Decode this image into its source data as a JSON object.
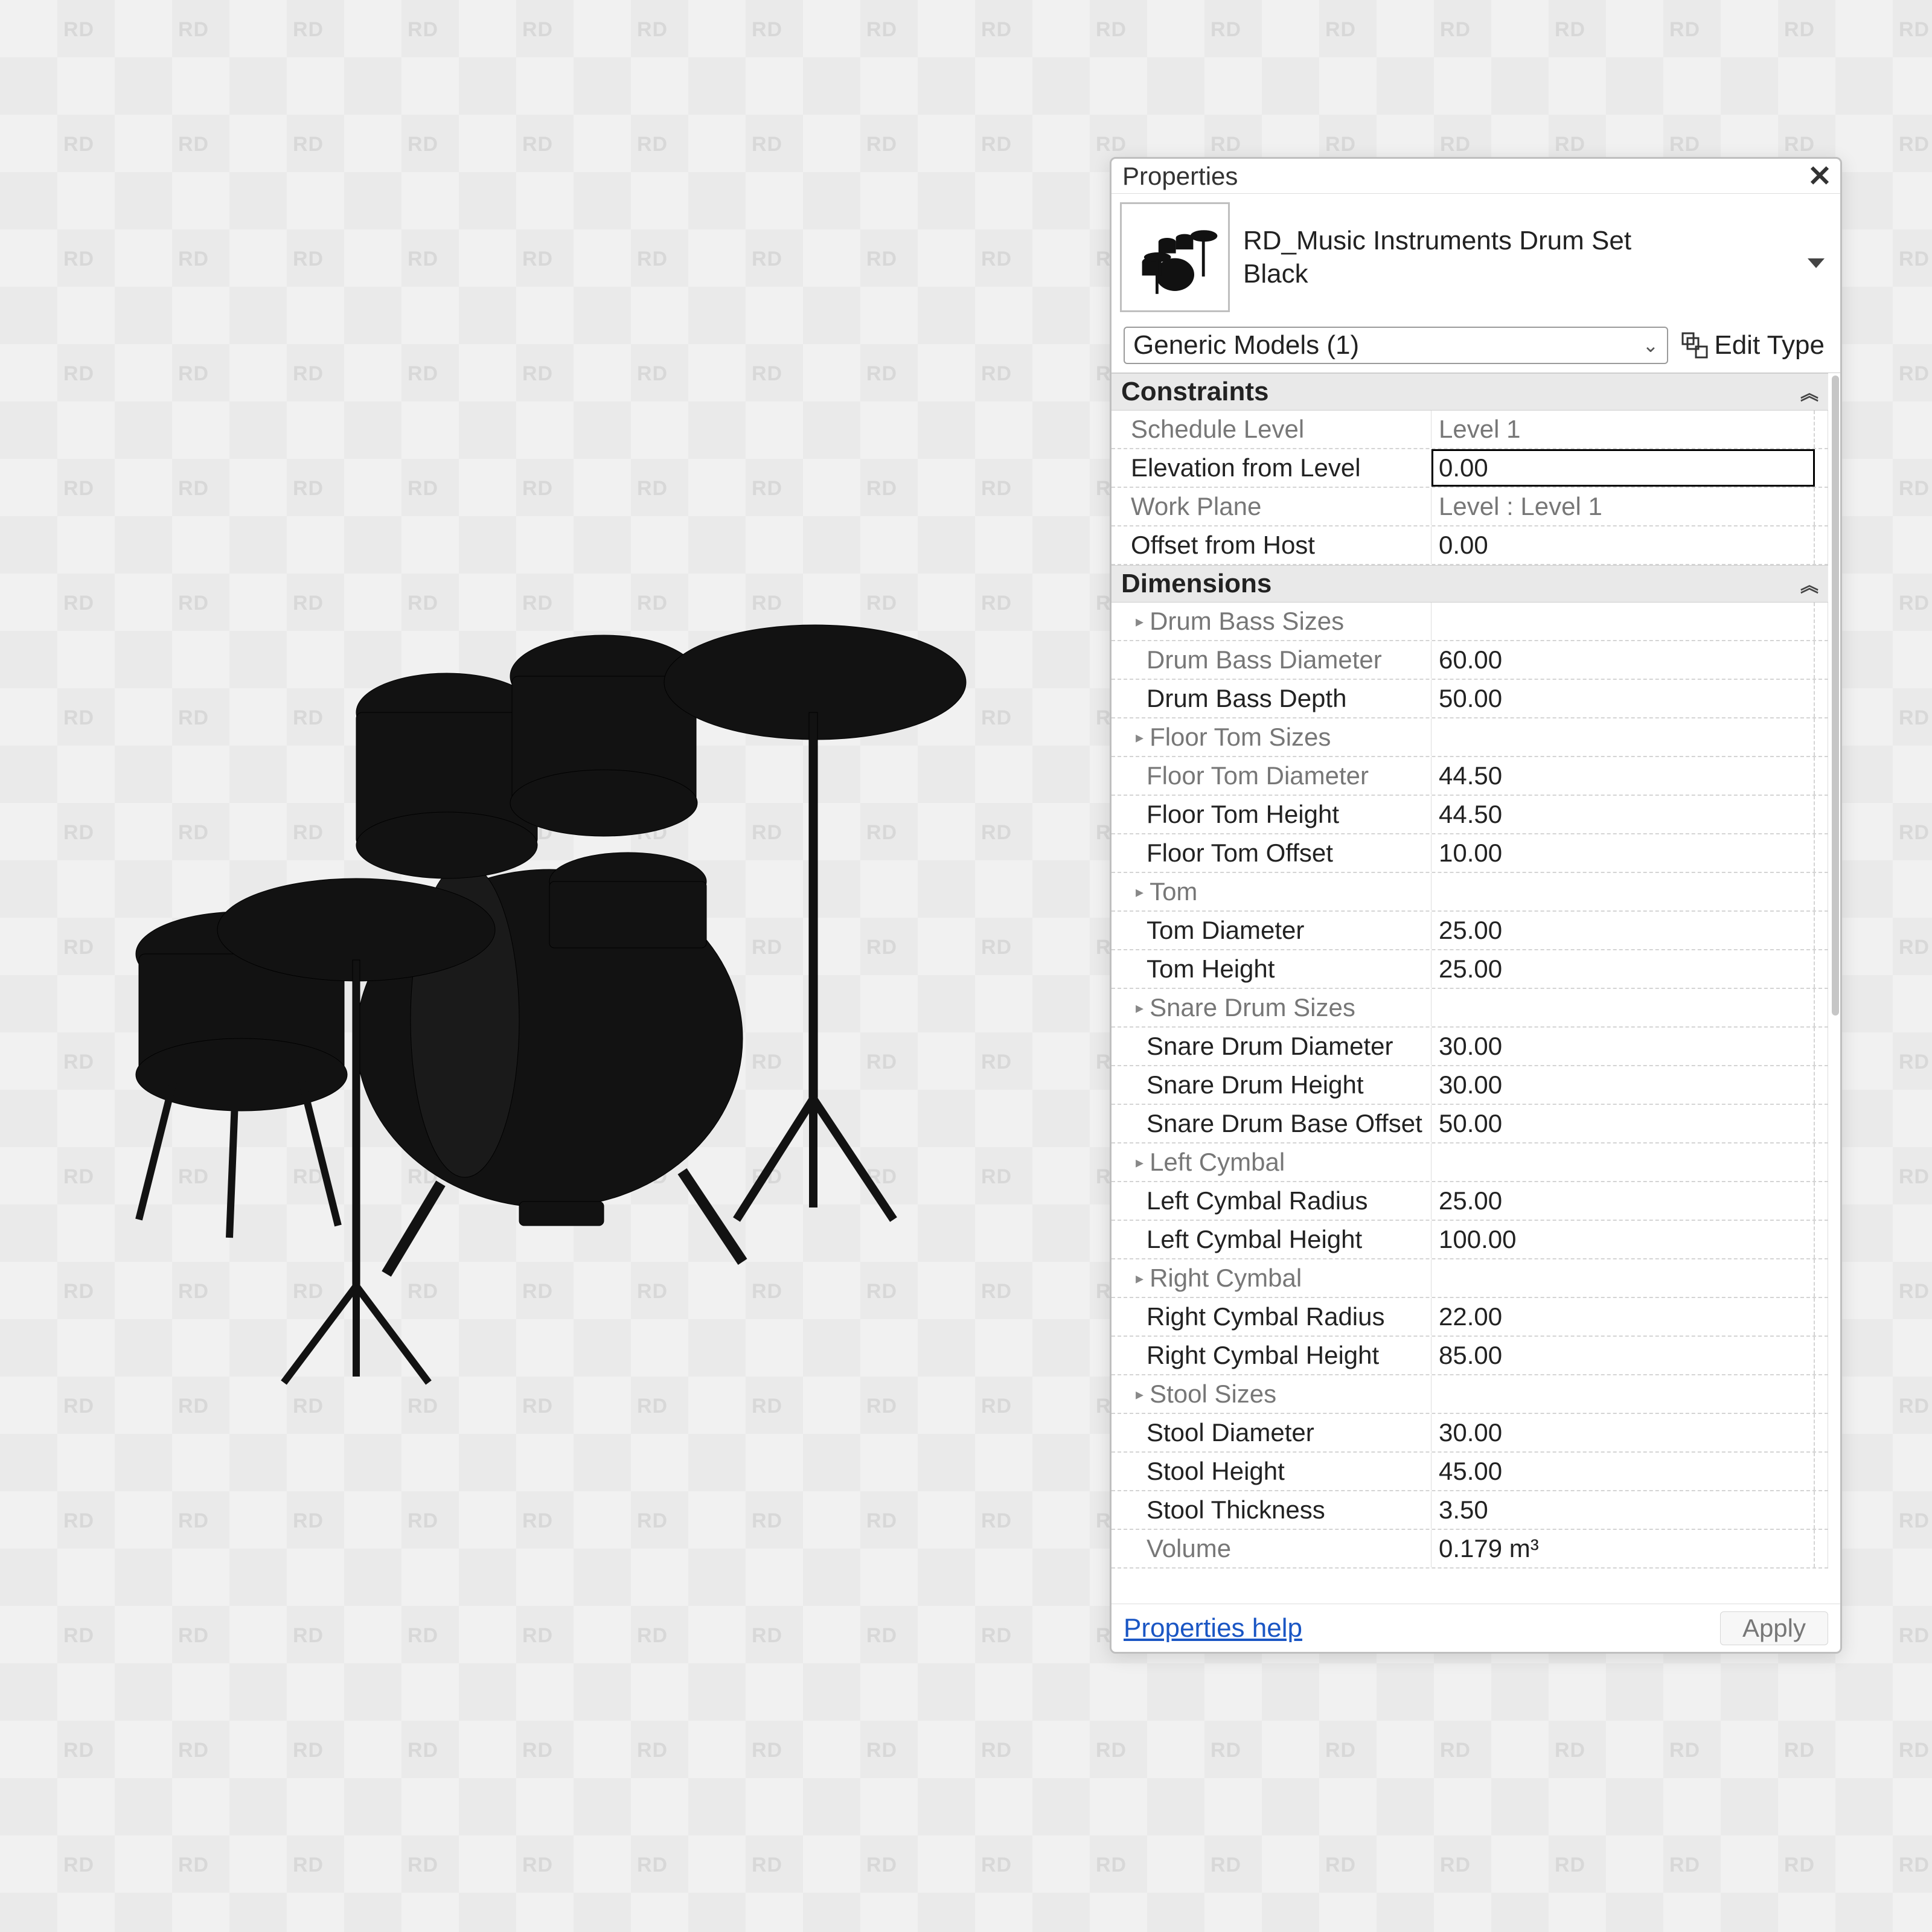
{
  "panel": {
    "title": "Properties",
    "family_name_line1": "RD_Music Instruments Drum Set",
    "family_name_line2": "Black",
    "selector": "Generic Models (1)",
    "edit_type_label": "Edit Type",
    "help_link": "Properties help",
    "apply_label": "Apply"
  },
  "groups": {
    "constraints": "Constraints",
    "dimensions": "Dimensions"
  },
  "constraints": {
    "schedule_level": {
      "label": "Schedule Level",
      "value": "Level 1"
    },
    "elevation_from_level": {
      "label": "Elevation from Level",
      "value": "0.00"
    },
    "work_plane": {
      "label": "Work Plane",
      "value": "Level : Level 1"
    },
    "offset_from_host": {
      "label": "Offset from Host",
      "value": "0.00"
    }
  },
  "dimensions": {
    "drum_bass_sizes": {
      "label": "Drum Bass Sizes"
    },
    "drum_bass_diameter": {
      "label": "Drum Bass Diameter",
      "value": "60.00"
    },
    "drum_bass_depth": {
      "label": "Drum Bass Depth",
      "value": "50.00"
    },
    "floor_tom_sizes": {
      "label": "Floor Tom Sizes"
    },
    "floor_tom_diameter": {
      "label": "Floor Tom Diameter",
      "value": "44.50"
    },
    "floor_tom_height": {
      "label": "Floor Tom Height",
      "value": "44.50"
    },
    "floor_tom_offset": {
      "label": "Floor Tom Offset",
      "value": "10.00"
    },
    "tom": {
      "label": "Tom"
    },
    "tom_diameter": {
      "label": "Tom Diameter",
      "value": "25.00"
    },
    "tom_height": {
      "label": "Tom Height",
      "value": "25.00"
    },
    "snare_drum_sizes": {
      "label": "Snare Drum Sizes"
    },
    "snare_drum_diameter": {
      "label": "Snare Drum Diameter",
      "value": "30.00"
    },
    "snare_drum_height": {
      "label": "Snare Drum Height",
      "value": "30.00"
    },
    "snare_drum_base_offset": {
      "label": "Snare Drum Base Offset",
      "value": "50.00"
    },
    "left_cymbal": {
      "label": "Left Cymbal"
    },
    "left_cymbal_radius": {
      "label": "Left Cymbal Radius",
      "value": "25.00"
    },
    "left_cymbal_height": {
      "label": "Left Cymbal Height",
      "value": "100.00"
    },
    "right_cymbal": {
      "label": "Right Cymbal"
    },
    "right_cymbal_radius": {
      "label": "Right Cymbal Radius",
      "value": "22.00"
    },
    "right_cymbal_height": {
      "label": "Right Cymbal Height",
      "value": "85.00"
    },
    "stool_sizes": {
      "label": "Stool Sizes"
    },
    "stool_diameter": {
      "label": "Stool Diameter",
      "value": "30.00"
    },
    "stool_height": {
      "label": "Stool Height",
      "value": "45.00"
    },
    "stool_thickness": {
      "label": "Stool Thickness",
      "value": "3.50"
    },
    "volume": {
      "label": "Volume",
      "value": "0.179 m³"
    }
  },
  "watermark": "RD"
}
